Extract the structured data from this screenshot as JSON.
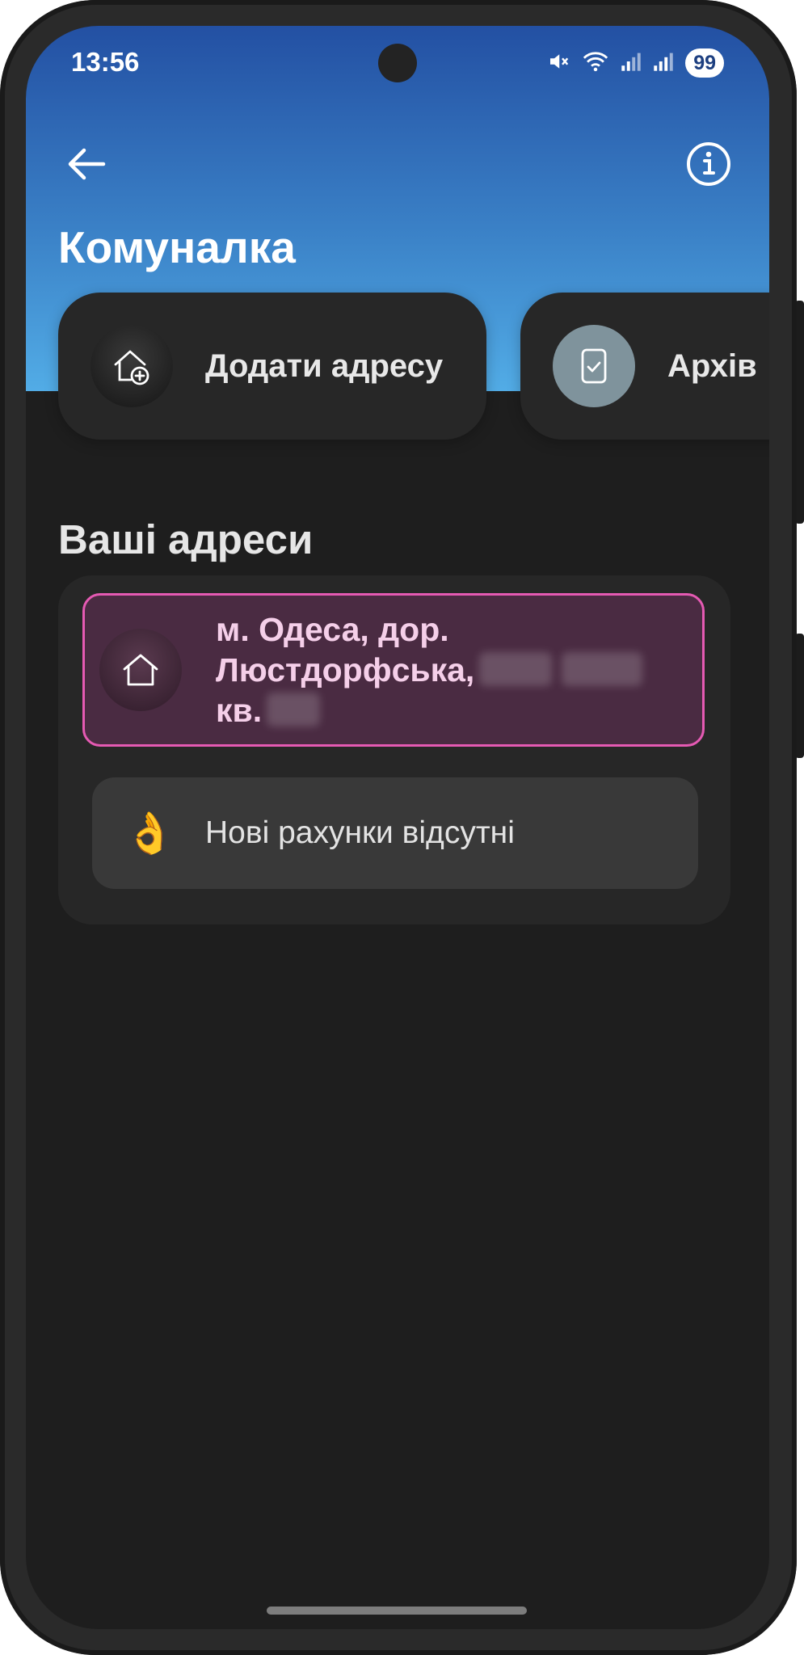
{
  "statusbar": {
    "time": "13:56",
    "battery": "99"
  },
  "header": {
    "title": "Комуналка"
  },
  "quick_actions": [
    {
      "label": "Додати адресу",
      "icon": "house-plus-icon"
    },
    {
      "label": "Архів",
      "icon": "checklist-icon"
    }
  ],
  "addresses": {
    "title": "Ваші адреси",
    "items": [
      {
        "line1": "м. Одеса, дор.",
        "line2": "Люстдорфська,",
        "line3": "кв.",
        "icon": "house-icon",
        "status_emoji": "👌",
        "status_text": "Нові рахунки відсутні"
      }
    ]
  },
  "colors": {
    "accent": "#e55ab3",
    "gradient_top": "#2350a3",
    "gradient_bottom": "#52ace6",
    "background": "#1e1e1e"
  }
}
